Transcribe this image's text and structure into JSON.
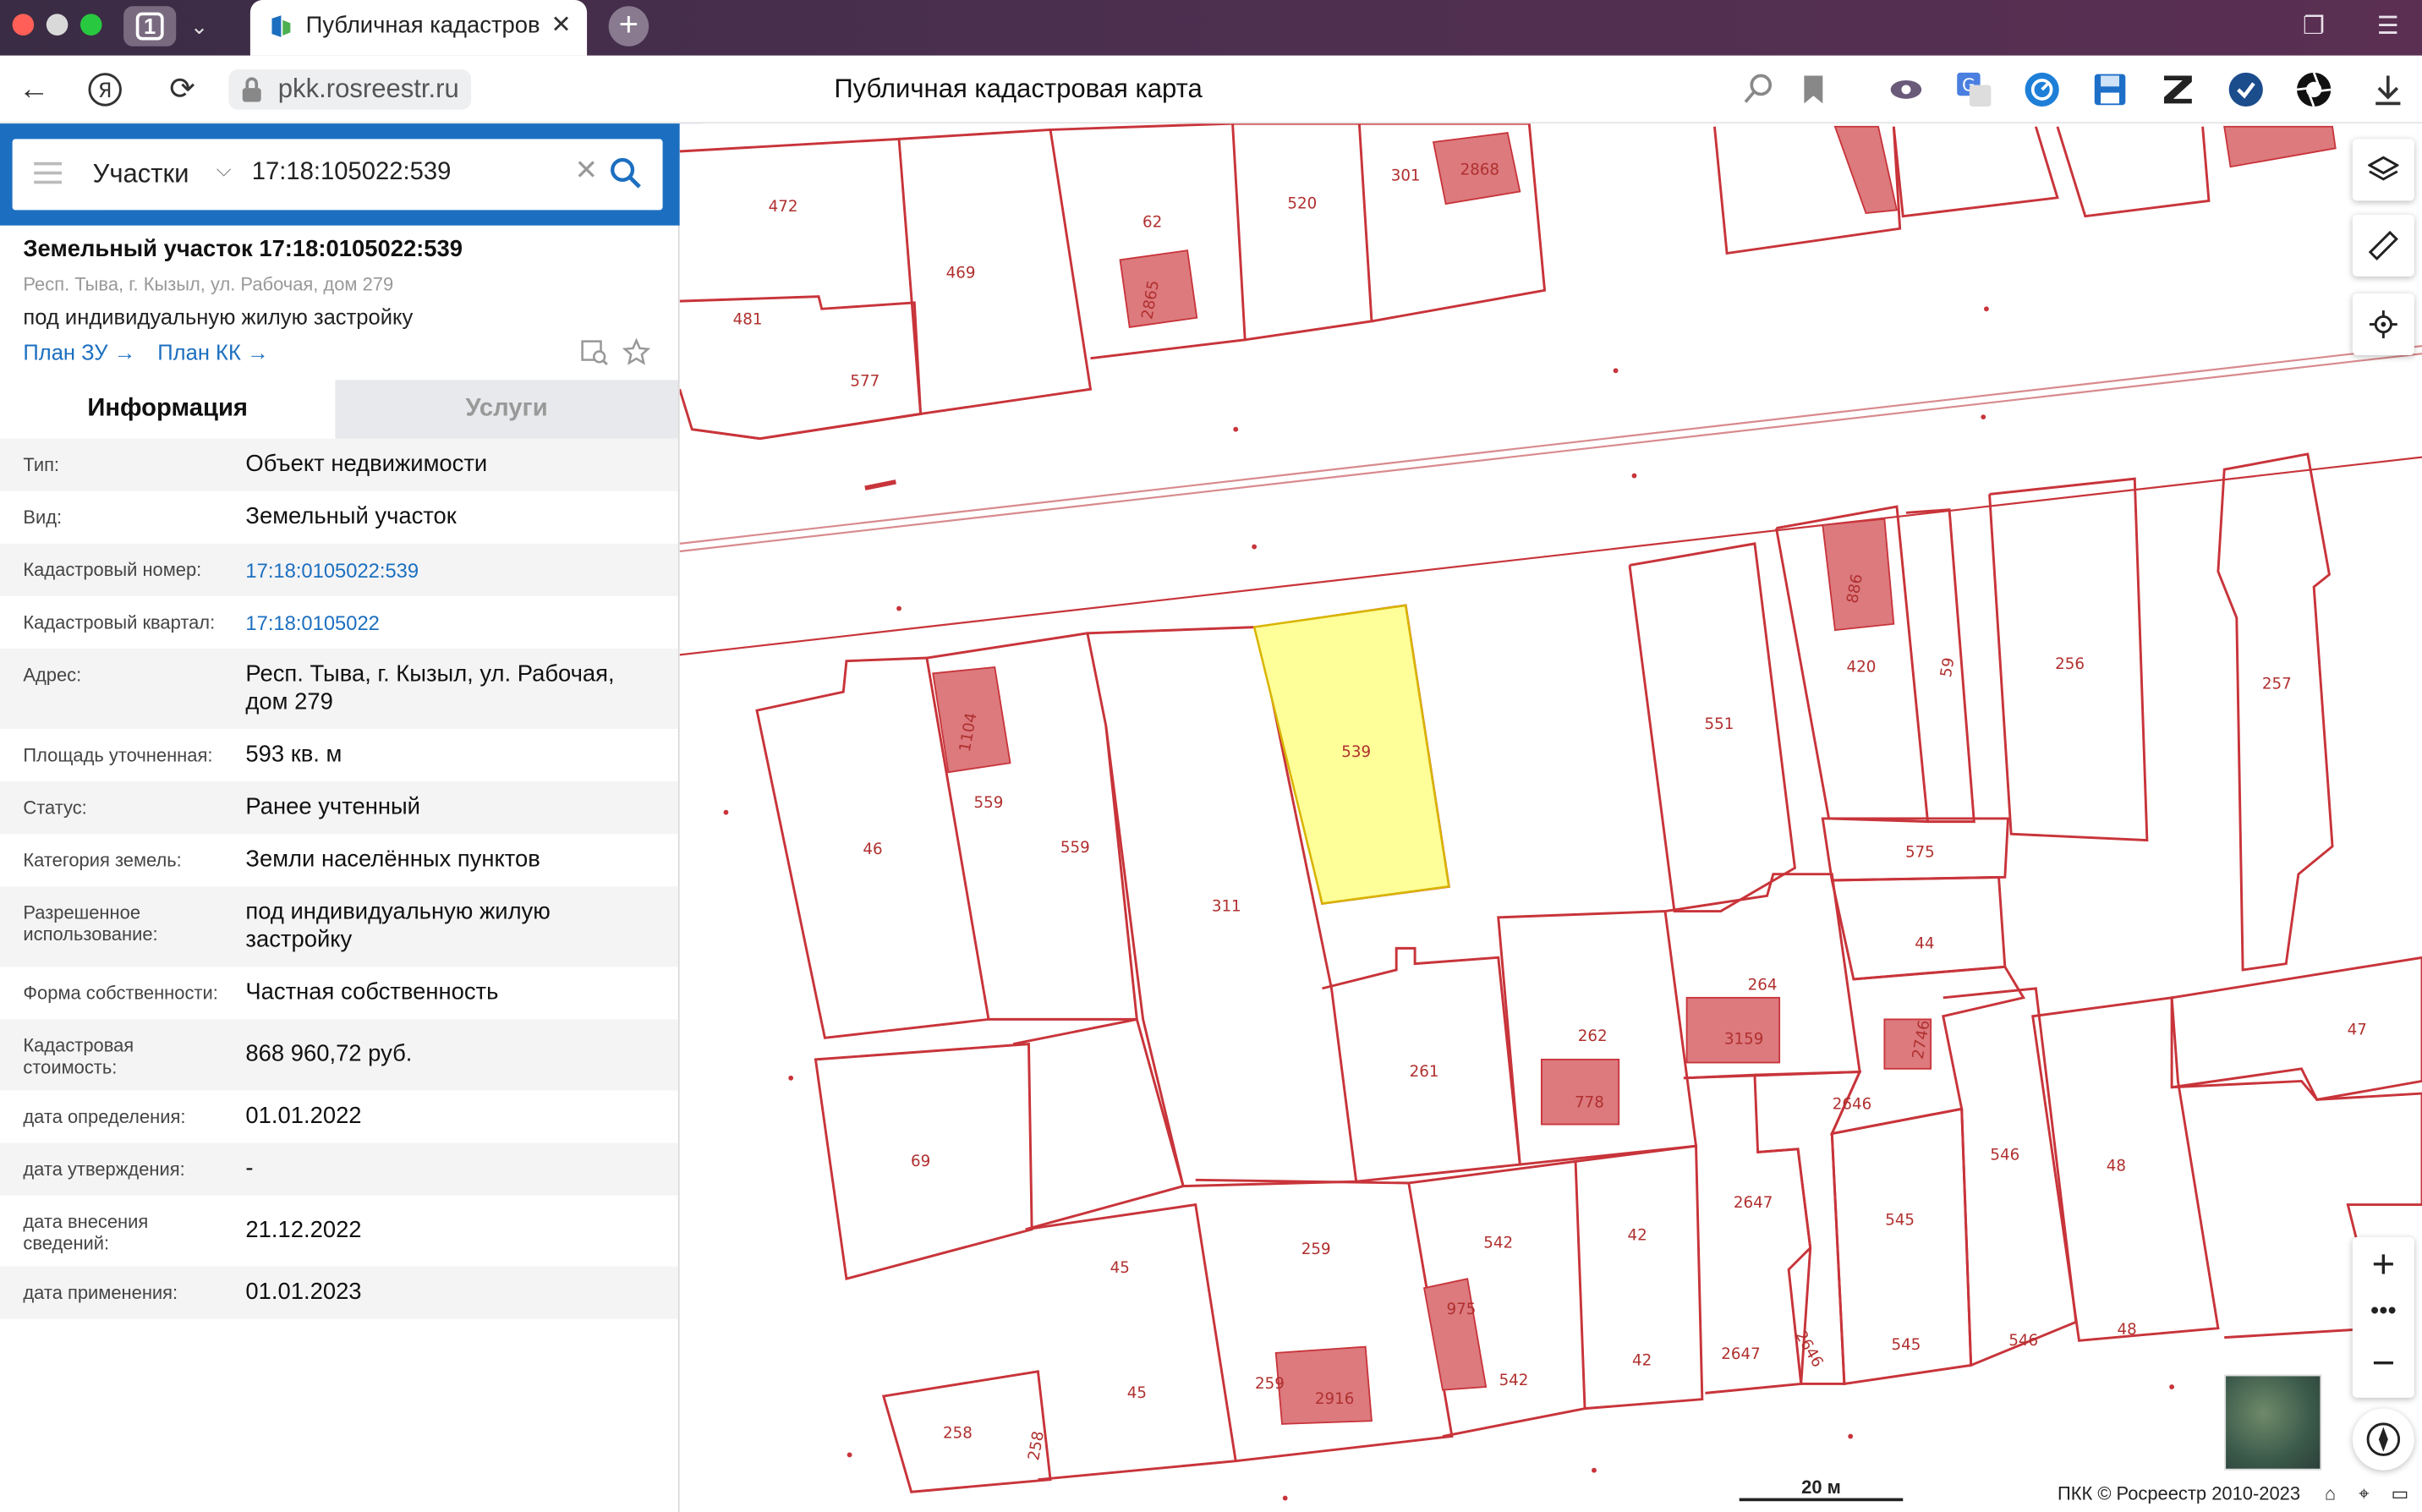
{
  "browser": {
    "tab_count": "1",
    "tab_title": "Публичная кадастров",
    "url": "pkk.rosreestr.ru",
    "page_title": "Публичная кадастровая карта"
  },
  "search": {
    "category": "Участки",
    "query": "17:18:105022:539"
  },
  "object": {
    "title": "Земельный участок 17:18:0105022:539",
    "address": "Респ. Тыва, г. Кызыл, ул. Рабочая, дом 279",
    "use": "под индивидуальную жилую застройку",
    "link1": "План ЗУ",
    "link2": "План КК"
  },
  "tabs": {
    "info": "Информация",
    "services": "Услуги"
  },
  "rows": [
    {
      "label": "Тип:",
      "value": "Объект недвижимости"
    },
    {
      "label": "Вид:",
      "value": "Земельный участок"
    },
    {
      "label": "Кадастровый номер:",
      "value": "17:18:0105022:539"
    },
    {
      "label": "Кадастровый квартал:",
      "value": "17:18:0105022"
    },
    {
      "label": "Адрес:",
      "value": "Респ. Тыва, г. Кызыл, ул. Рабочая, дом 279"
    },
    {
      "label": "Площадь уточненная:",
      "value": "593 кв. м"
    },
    {
      "label": "Статус:",
      "value": "Ранее учтенный"
    },
    {
      "label": "Категория земель:",
      "value": "Земли населённых пунктов"
    },
    {
      "label": "Разрешенное использование:",
      "value": "под индивидуальную жилую застройку"
    },
    {
      "label": "Форма собственности:",
      "value": "Частная собственность"
    },
    {
      "label": "Кадастровая стоимость:",
      "value": "868 960,72 руб."
    },
    {
      "label": "дата определения:",
      "value": "01.01.2022"
    },
    {
      "label": "дата утверждения:",
      "value": "-"
    },
    {
      "label": "дата внесения сведений:",
      "value": "21.12.2022"
    },
    {
      "label": "дата применения:",
      "value": "01.01.2023"
    }
  ],
  "map": {
    "scale_label": "20 м",
    "copyright": "ПКК © Росреестр 2010-2023",
    "parcel_labels": [
      "472",
      "469",
      "481",
      "577",
      "62",
      "2865",
      "520",
      "301",
      "2868",
      "539",
      "46",
      "559",
      "559",
      "1104",
      "311",
      "551",
      "886",
      "420",
      "59",
      "256",
      "257",
      "575",
      "44",
      "264",
      "3159",
      "2746",
      "262",
      "778",
      "261",
      "2646",
      "47",
      "69",
      "546",
      "48",
      "2647",
      "545",
      "42",
      "542",
      "975",
      "259",
      "45",
      "45",
      "2916",
      "258",
      "2647",
      "2646",
      "545",
      "546",
      "48",
      "42",
      "542",
      "259",
      "258"
    ]
  },
  "colors": {
    "accent": "#1c6fc0",
    "parcel_line": "#c8343a",
    "selected_fill": "#ffff99",
    "building_fill": "#dc7a7e"
  }
}
